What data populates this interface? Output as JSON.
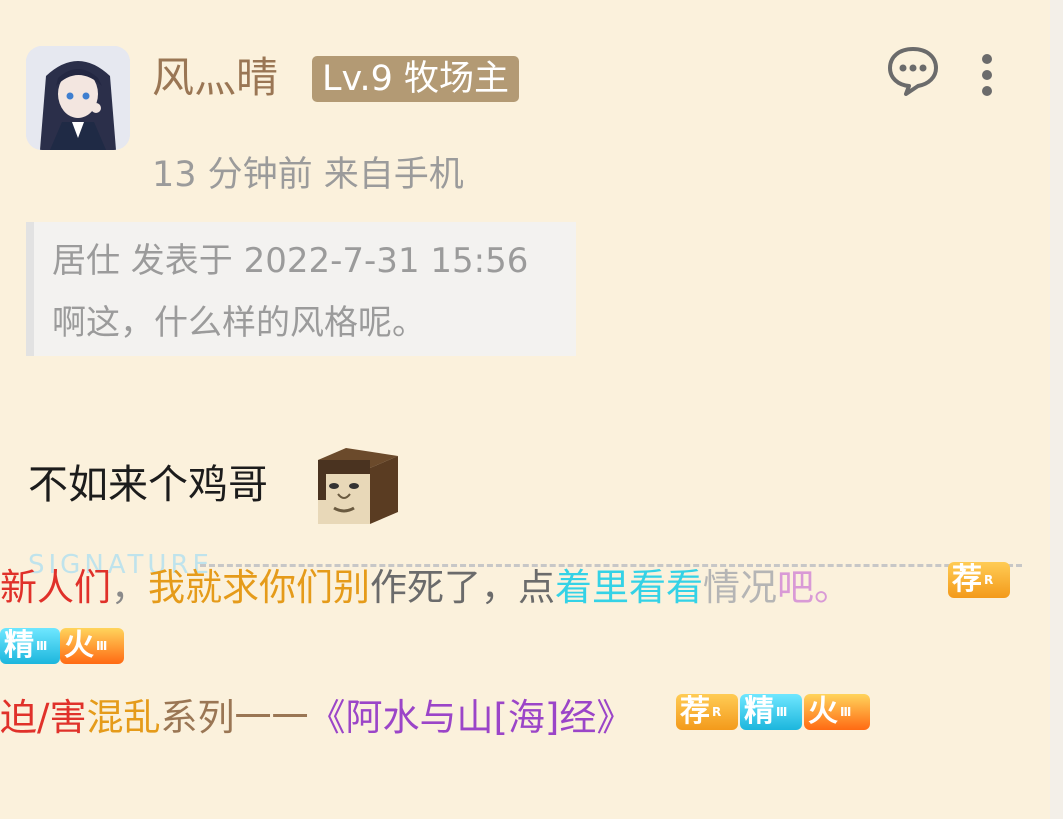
{
  "post": {
    "username": "风灬晴",
    "badge": "Lv.9 牧场主",
    "meta": "13 分钟前 来自手机",
    "icons": {
      "comment": "comment-icon",
      "more": "more-vertical-icon"
    }
  },
  "quote": {
    "header": "居仕 发表于 2022-7-31 15:56",
    "text": "啊这，什么样的风格呢。"
  },
  "body": {
    "text": "不如来个鸡哥",
    "emoji": "blocky-face-emoji"
  },
  "signature": {
    "watermark": "SIGNATURE",
    "line1": [
      {
        "text": "新人们",
        "color": "#e0312a"
      },
      {
        "text": "，",
        "color": "#8a8a8a"
      },
      {
        "text": "我就求你们别",
        "color": "#e59b1a"
      },
      {
        "text": "作死了，点",
        "color": "#6b6b6b"
      },
      {
        "text": "着里看看",
        "color": "#34d2e6"
      },
      {
        "text": "情况",
        "color": "#b5b5b5"
      },
      {
        "text": "吧。",
        "color": "#d99ad6"
      }
    ],
    "line2": [
      {
        "text": "迫/害",
        "color": "#e0312a"
      },
      {
        "text": "混乱",
        "color": "#e59b1a"
      },
      {
        "text": "系列一一",
        "color": "#9a7654"
      },
      {
        "text": "《阿水与山[海]经》",
        "color": "#9b45c8"
      }
    ],
    "tags": {
      "rec": "荐",
      "jing": "精",
      "huo": "火"
    }
  },
  "colors": {
    "background": "#fbf1dc",
    "username": "#9a7654",
    "badge": "#b39a74"
  }
}
